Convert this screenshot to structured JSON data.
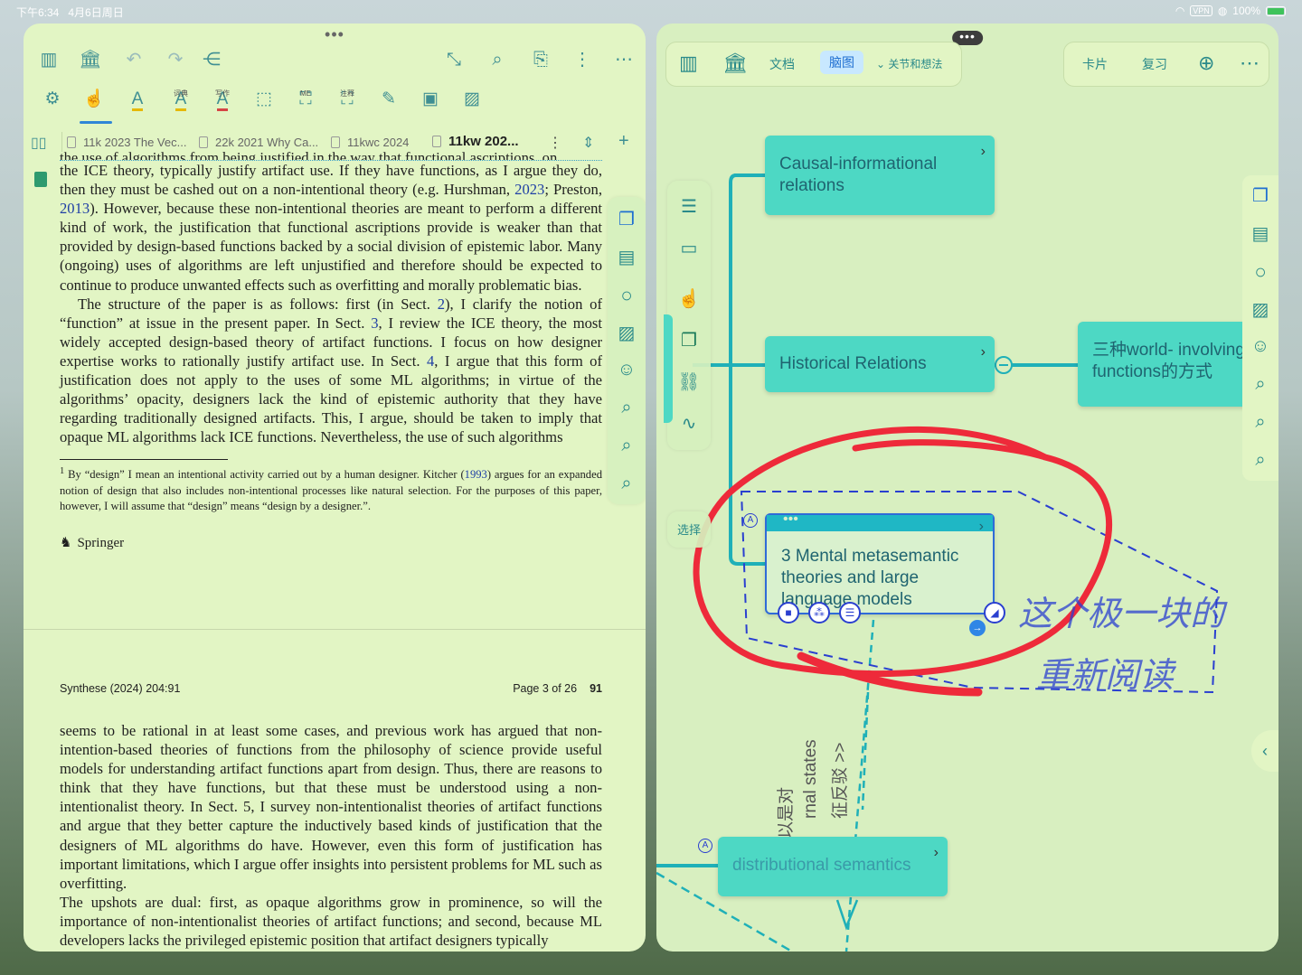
{
  "status": {
    "time": "下午6:34",
    "date": "4月6日周日",
    "vpn": "VPN",
    "battery": "100%"
  },
  "left": {
    "toolbar2_sublabels": {
      "dict": "词典",
      "write": "写作",
      "me": "ME",
      "note": "注释"
    },
    "tabs": [
      {
        "label": "11k 2023 The Vec..."
      },
      {
        "label": "22k 2021 Why Ca..."
      },
      {
        "label": "11kwc 2024"
      },
      {
        "label": "11kw 202..."
      }
    ],
    "paper_p1": [
      "the use of algorithms from being justified in the way that functional ascriptions, on",
      "the ICE theory, typically justify artifact use. If they have functions, as I argue they do, then they must be cashed out on a non-intentional theory (e.g. Hurshman, ",
      "2023",
      "; Preston, ",
      "2013",
      "). However, because these non-intentional theories are meant to perform a different kind of work, the justification that functional ascriptions provide is weaker than that provided by design-based functions backed by a social division of epistemic labor. Many (ongoing) uses of algorithms are left unjustified and therefore should be expected to continue to produce unwanted effects such as overfitting and morally problematic bias."
    ],
    "paper_p2": [
      "The structure of the paper is as follows: first (in Sect. ",
      "2",
      "), I clarify the notion of “function” at issue in the present paper. In Sect. ",
      "3",
      ", I review the ICE theory, the most widely accepted design-based theory of artifact functions. I focus on how designer expertise works to rationally justify artifact use. In Sect. ",
      "4",
      ", I argue that this form of justification does not apply to the uses of some ML algorithms; in virtue of the algorithms’ opacity, designers lack the kind of epistemic authority that they have regarding traditionally designed artifacts. This, I argue, should be taken to imply that opaque ML algorithms lack ICE functions. Nevertheless, the use of such algorithms"
    ],
    "footnote": [
      "1",
      " By “design” I mean an intentional activity carried out by a human designer. Kitcher (",
      "1993",
      ") argues for an expanded notion of design that also includes non-intentional processes like natural selection. For the purposes of this paper, however, I will assume that “design” means “design by a designer.”."
    ],
    "publisher": "Springer",
    "running_head": {
      "journal": "Synthese (2024) 204:91",
      "page": "Page 3 of 26",
      "article": "91"
    },
    "paper_p3": [
      "seems to be rational in at least some cases, and previous work has argued that non-intention-based theories of functions from the philosophy of science provide useful models for understanding artifact functions apart from design. Thus, there are reasons to think that they have functions, but that these must be understood using a non-intentionalist theory. In Sect. ",
      "5",
      ", I survey non-intentionalist theories of artifact functions and argue that they better capture the inductively based kinds of justification that the designers of ML algorithms do have. However, even this form of justification has important limitations, which I argue offer insights into persistent problems for ML such as overfitting."
    ],
    "paper_p4": "The upshots are dual: first, as opaque algorithms grow in prominence, so will the importance of non-intentionalist theories of artifact functions; and second, because ML developers lacks the privileged epistemic position that artifact designers typically"
  },
  "right": {
    "toolbar": {
      "doc": "文档",
      "mindmap": "脑图",
      "filter": "关节和想法",
      "cards": "卡片",
      "review": "复习"
    },
    "nodes": {
      "causal": "Causal-informational relations",
      "historical": "Historical Relations",
      "threeworld": "三种world- involving functions的方式",
      "mental": "3 Mental metasemantic theories and large language models",
      "distributional": "distributional semantics"
    },
    "side_label": "选择",
    "rotated_text_1": "rnal states",
    "rotated_text_2": "征反驳 >>",
    "rotated_text_3": "以是对",
    "handwriting_1": "这个极一块的",
    "handwriting_2": "重新阅读"
  }
}
